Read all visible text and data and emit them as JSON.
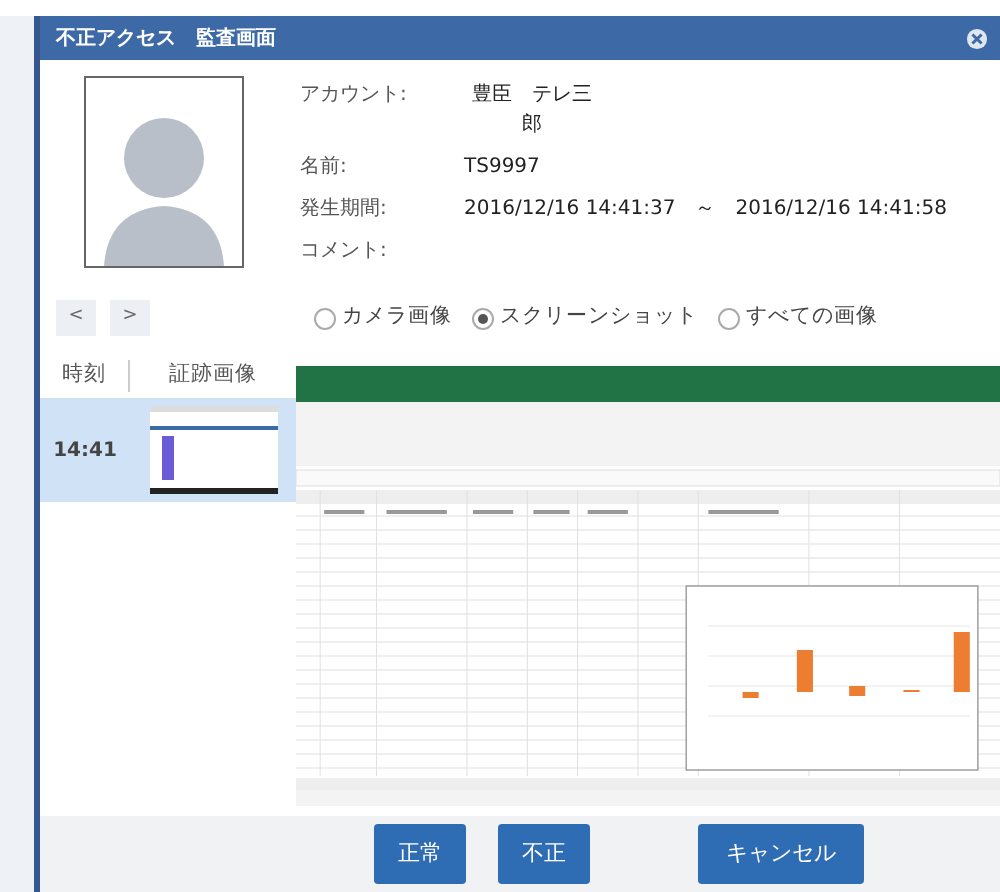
{
  "window": {
    "title": "不正アクセス　監査画面"
  },
  "fields": [
    {
      "label": "アカウント:",
      "value": "豊臣　テレ三郎"
    },
    {
      "label": "名前:",
      "value": "TS9997"
    },
    {
      "label": "発生期間:",
      "value": "2016/12/16 14:41:37　～　2016/12/16 14:41:58"
    },
    {
      "label": "コメント:"
    }
  ],
  "nav_buttons": [
    "<",
    ">"
  ],
  "image_filters": [
    {
      "label": "カメラ画像",
      "selected": false
    },
    {
      "label": "スクリーンショット",
      "selected": true
    },
    {
      "label": "すべての画像",
      "selected": false
    }
  ],
  "table": {
    "columns": [
      "時刻",
      "証跡画像"
    ],
    "rows": [
      {
        "time": "14:41",
        "selected": true
      }
    ]
  },
  "buttons": [
    "正常",
    "不正",
    "キャンセル"
  ]
}
